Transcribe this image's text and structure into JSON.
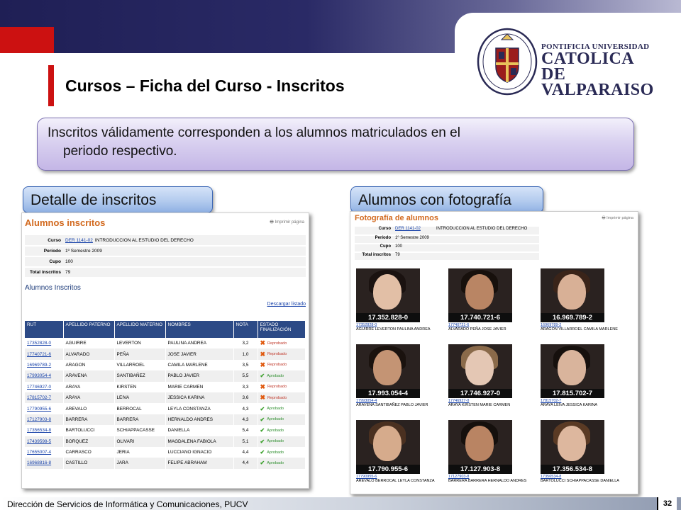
{
  "slide": {
    "title": "Cursos – Ficha del Curso - Inscritos",
    "info_line1": "Inscritos válidamente corresponden a los alumnos matriculados en el",
    "info_line2": "periodo respectivo.",
    "label_left": "Detalle de inscritos",
    "label_right": "Alumnos con fotografía",
    "footer": "Dirección de Servicios de Informática y Comunicaciones, PUCV",
    "page_number": "32"
  },
  "logo": {
    "line1": "PONTIFICIA UNIVERSIDAD",
    "line2": "CATOLICA",
    "line3": "DE VALPARAISO"
  },
  "left_screen": {
    "title": "Alumnos inscritos",
    "print_label": "Imprimir página",
    "info": [
      {
        "key": "Curso",
        "code": "DER 1141-02",
        "value": "INTRODUCCION AL ESTUDIO DEL DERECHO"
      },
      {
        "key": "Período",
        "code": "",
        "value": "1º Semestre 2009"
      },
      {
        "key": "Cupo",
        "code": "",
        "value": "100"
      },
      {
        "key": "Total inscritos",
        "code": "",
        "value": "79"
      }
    ],
    "subtitle": "Alumnos Inscritos",
    "download_label": "Descargar listado",
    "headers": [
      "RUT",
      "APELLIDO PATERNO",
      "APELLIDO MATERNO",
      "NOMBRES",
      "NOTA",
      "ESTADO FINALIZACIÓN"
    ],
    "rows": [
      [
        "17352828-0",
        "AGUIRRE",
        "LEVERTON",
        "PAULINA ANDREA",
        "3,2",
        "Reprobado"
      ],
      [
        "17740721-6",
        "ALVARADO",
        "PEÑA",
        "JOSE JAVIER",
        "1,0",
        "Reprobado"
      ],
      [
        "16969789-2",
        "ARAGON",
        "VILLARROEL",
        "CAMILA MARLENE",
        "3,5",
        "Reprobado"
      ],
      [
        "17993054-4",
        "ARAVENA",
        "SANTIBAÑEZ",
        "PABLO JAVIER",
        "5,5",
        "Aprobado"
      ],
      [
        "17746927-0",
        "ARAYA",
        "KIRSTEN",
        "MARIE CARMEN",
        "3,3",
        "Reprobado"
      ],
      [
        "17815702-7",
        "ARAYA",
        "LEIVA",
        "JESSICA KARINA",
        "3,6",
        "Reprobado"
      ],
      [
        "17790955-6",
        "AREVALO",
        "BERROCAL",
        "LEYLA CONSTANZA",
        "4,3",
        "Aprobado"
      ],
      [
        "17127903-8",
        "BARRERA",
        "BARRERA",
        "HERNALDO ANDRES",
        "4,3",
        "Aprobado"
      ],
      [
        "17356534-8",
        "BARTOLUCCI",
        "SCHIAPPACASSE",
        "DANIELLA",
        "5,4",
        "Aprobado"
      ],
      [
        "17439598-5",
        "BORQUEZ",
        "OLIVARI",
        "MAGDALENA FABIOLA",
        "5,1",
        "Aprobado"
      ],
      [
        "17655007-4",
        "CARRASCO",
        "JERIA",
        "LUCCIANO IGNACIO",
        "4,4",
        "Aprobado"
      ],
      [
        "16968816-8",
        "CASTILLO",
        "JARA",
        "FELIPE ABRAHAM",
        "4,4",
        "Aprobado"
      ]
    ]
  },
  "right_screen": {
    "title": "Fotografía de alumnos",
    "print_label": "Imprimir página",
    "info": [
      {
        "key": "Curso",
        "code": "DER 1141-02",
        "value": "INTRODUCCION AL ESTUDIO DEL DERECHO"
      },
      {
        "key": "Período",
        "code": "1º Semestre 2009",
        "value": ""
      },
      {
        "key": "Cupo",
        "code": "100",
        "value": ""
      },
      {
        "key": "Total inscritos",
        "code": "79",
        "value": ""
      }
    ],
    "photos": [
      {
        "plate": "17.352.828-0",
        "rut": "17352828-0",
        "name": "AGUIRRE LEVERTON PAULINA ANDREA",
        "skin": "#e2bfa6",
        "hair": "#1a1210"
      },
      {
        "plate": "17.740.721-6",
        "rut": "17740721-6",
        "name": "ALVARADO PEÑA JOSE JAVIER",
        "skin": "#b98564",
        "hair": "#17100c"
      },
      {
        "plate": "16.969.789-2",
        "rut": "16969789-2",
        "name": "ARAGON VILLARROEL CAMILA MARLENE",
        "skin": "#d8b096",
        "hair": "#3a2419"
      },
      {
        "plate": "17.993.054-4",
        "rut": "17993054-4",
        "name": "ARAVENA SANTIBAÑEZ PABLO JAVIER",
        "skin": "#c49474",
        "hair": "#1a120e"
      },
      {
        "plate": "17.746.927-0",
        "rut": "17746927-0",
        "name": "ARAYA KIRSTEN MARIE CARMEN",
        "skin": "#e4c7b4",
        "hair": "#8a6a4a"
      },
      {
        "plate": "17.815.702-7",
        "rut": "17815702-7",
        "name": "ARAYA LEIVA JESSICA KARINA",
        "skin": "#d9b49c",
        "hair": "#16100d"
      },
      {
        "plate": "17.790.955-6",
        "rut": "17790955-6",
        "name": "AREVALO BERROCAL LEYLA CONSTANZA",
        "skin": "#d6ab8c",
        "hair": "#4a3020"
      },
      {
        "plate": "17.127.903-8",
        "rut": "17127903-8",
        "name": "BARRERA BARRERA HERNALDO ANDRES",
        "skin": "#b98463",
        "hair": "#15100d"
      },
      {
        "plate": "17.356.534-8",
        "rut": "17356534-8",
        "name": "BARTOLUCCI SCHIAPPACASSE DANIELLA",
        "skin": "#ddb79e",
        "hair": "#5a3a24"
      }
    ]
  },
  "colors": {
    "accent_red": "#cc1111",
    "banner_navy": "#1f1f55",
    "link_blue": "#1a44aa",
    "table_header": "#2c4a86",
    "title_orange": "#d2691e",
    "reprobado": "#c0392b",
    "aprobado": "#2f8f2f"
  },
  "icons": {
    "status_reprobado": "x-mark-icon",
    "status_aprobado": "checkmark-icon",
    "print": "printer-icon"
  }
}
